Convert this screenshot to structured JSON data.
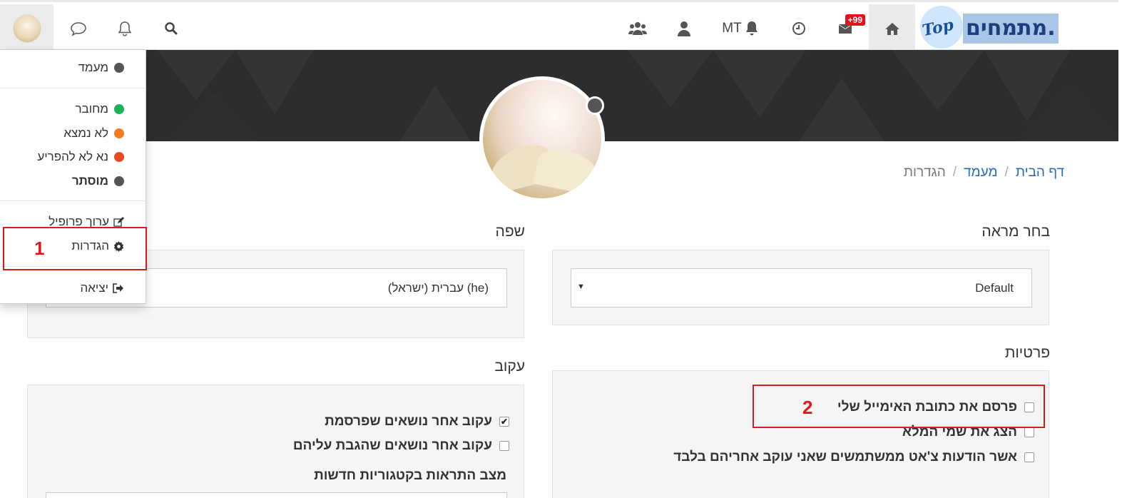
{
  "topbar": {
    "logo_text": "מתמחים.",
    "logo_top": "Top",
    "unread_badge": "+99",
    "notifications_label": "MT",
    "icons": [
      "home-icon",
      "inbox-icon",
      "clock-icon",
      "bell-icon",
      "user-icon",
      "users-icon",
      "search-icon",
      "bell-icon",
      "chat-icon",
      "avatar"
    ]
  },
  "breadcrumb": {
    "home": "דף הבית",
    "status": "מעמד",
    "current": "הגדרות"
  },
  "skin": {
    "title": "בחר מראה",
    "selected": "Default"
  },
  "language": {
    "title": "שפה",
    "selected": "עברית (ישראל) (he)"
  },
  "privacy": {
    "title": "פרטיות",
    "items": [
      {
        "label": "פרסם את כתובת האימייל שלי",
        "checked": false
      },
      {
        "label": "הצג את שמי המלא",
        "checked": false
      },
      {
        "label": "אשר הודעות צ'אט ממשתמשים שאני עוקב אחריהם בלבד",
        "checked": false
      }
    ]
  },
  "follow": {
    "title": "עקוב",
    "items": [
      {
        "label": "עקוב אחר נושאים שפרסמת",
        "checked": true
      },
      {
        "label": "עקוב אחר נושאים שהגבת עליהם",
        "checked": false
      }
    ],
    "new_categories_label": "מצב התראות בקטגוריות חדשות"
  },
  "dropdown": {
    "status_header": "מעמד",
    "statuses": [
      {
        "label": "מחובר",
        "color": "#1ab35b"
      },
      {
        "label": "לא נמצא",
        "color": "#f5791f"
      },
      {
        "label": "נא לא להפריע",
        "color": "#ea4a1f"
      },
      {
        "label": "מוסתר",
        "color": "#555555"
      }
    ],
    "edit_profile": "ערוך פרופיל",
    "settings": "הגדרות",
    "logout": "יציאה"
  },
  "annotations": {
    "box1": "1",
    "box2": "2",
    "color": "#d81c1c"
  }
}
